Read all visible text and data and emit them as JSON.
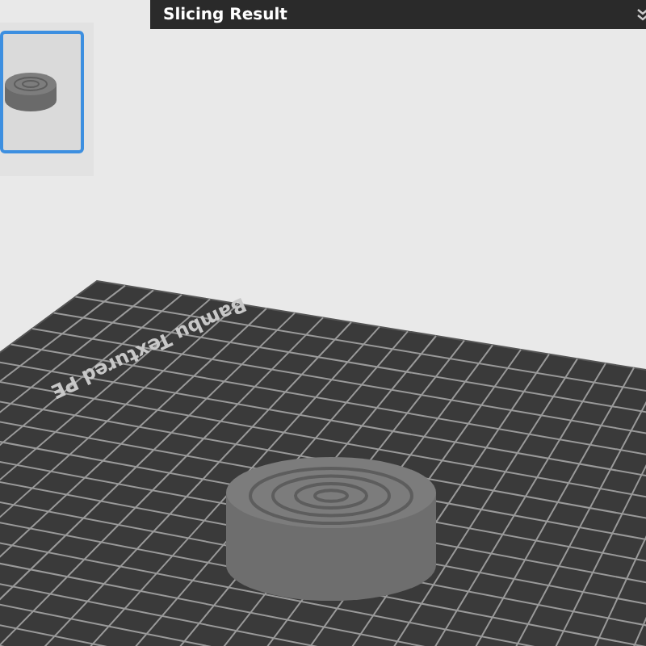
{
  "slicing_panel": {
    "title": "Slicing Result"
  },
  "plate_thumbnails": [
    {
      "selected": true
    }
  ],
  "build_plate": {
    "label": "Bambu Textured PE"
  }
}
